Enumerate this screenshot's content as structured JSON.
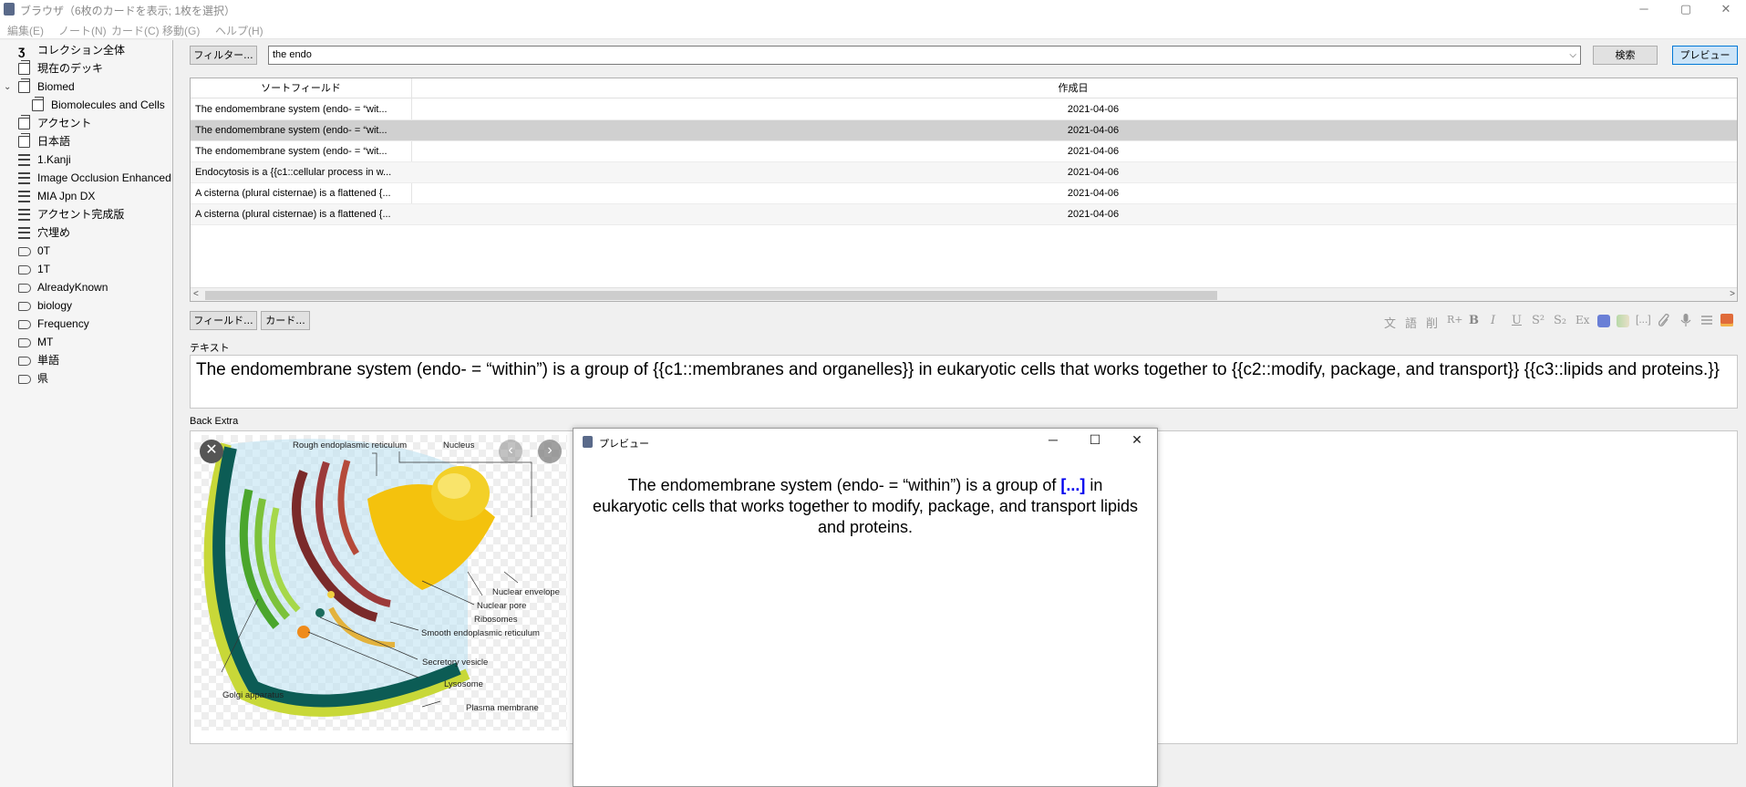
{
  "window": {
    "title": "ブラウザ（6枚のカードを表示; 1枚を選択）",
    "controls": [
      "─",
      "▢",
      "✕"
    ]
  },
  "menu": [
    "編集(E)",
    "ノート(N)",
    "カード(C)",
    "移動(G)",
    "ヘルプ(H)"
  ],
  "sidebar": {
    "items": [
      {
        "label": "コレクション全体",
        "icon": "collection-icon"
      },
      {
        "label": "現在のデッキ",
        "icon": "deck-icon"
      },
      {
        "label": "Biomed",
        "icon": "deck-icon",
        "expander": "⌄"
      },
      {
        "label": "Biomolecules and Cells",
        "icon": "deck-icon"
      },
      {
        "label": "アクセント",
        "icon": "deck-icon"
      },
      {
        "label": "日本語",
        "icon": "deck-icon"
      },
      {
        "label": "1.Kanji",
        "icon": "notetype-icon"
      },
      {
        "label": "Image Occlusion Enhanced",
        "icon": "notetype-icon"
      },
      {
        "label": "MIA Jpn DX",
        "icon": "notetype-icon"
      },
      {
        "label": "アクセント完成版",
        "icon": "notetype-icon"
      },
      {
        "label": "穴埋め",
        "icon": "notetype-icon"
      },
      {
        "label": "0T",
        "icon": "tag-icon"
      },
      {
        "label": "1T",
        "icon": "tag-icon"
      },
      {
        "label": "AlreadyKnown",
        "icon": "tag-icon"
      },
      {
        "label": "biology",
        "icon": "tag-icon"
      },
      {
        "label": "Frequency",
        "icon": "tag-icon"
      },
      {
        "label": "MT",
        "icon": "tag-icon"
      },
      {
        "label": "単語",
        "icon": "tag-icon"
      },
      {
        "label": "県",
        "icon": "tag-icon"
      }
    ]
  },
  "toolbar": {
    "filter_label": "フィルター...",
    "search_value": "the endo",
    "search_label": "検索",
    "preview_label": "プレビュー"
  },
  "table": {
    "columns": [
      "ソートフィールド",
      "作成日"
    ],
    "rows": [
      {
        "sort": "The endomembrane system (endo- = “wit...",
        "date": "2021-04-06"
      },
      {
        "sort": "The endomembrane system (endo- = “wit...",
        "date": "2021-04-06"
      },
      {
        "sort": "The endomembrane system (endo- = “wit...",
        "date": "2021-04-06"
      },
      {
        "sort": "Endocytosis is a {{c1::cellular process in w...",
        "date": "2021-04-06"
      },
      {
        "sort": "A cisterna (plural cisternae) is a flattened {...",
        "date": "2021-04-06"
      },
      {
        "sort": "A cisterna (plural cisternae) is a flattened {...",
        "date": "2021-04-06"
      }
    ],
    "selected_row": 1
  },
  "editor": {
    "fields_button": "フィールド...",
    "cards_button": "カード...",
    "format_icons": [
      "文",
      "語",
      "削",
      "R+",
      "B",
      "I",
      "U",
      "S²",
      "S₂",
      "Ex"
    ],
    "text_label": "テキスト",
    "text_value": "The endomembrane system (endo- = “within”) is a group of {{c1::membranes and organelles}} in eukaryotic cells that works together to {{c2::modify, package, and transport}} {{c3::lipids and proteins.}}",
    "back_extra_label": "Back Extra"
  },
  "image_labels": {
    "rough_er": "Rough endoplasmic reticulum",
    "nucleus": "Nucleus",
    "nuclear_envelope": "Nuclear envelope",
    "nuclear_pore": "Nuclear pore",
    "ribosomes": "Ribosomes",
    "smooth_er": "Smooth endoplasmic reticulum",
    "secretory_vesicle": "Secretory vesicle",
    "lysosome": "Lysosome",
    "golgi": "Golgi apparatus",
    "plasma_membrane": "Plasma membrane"
  },
  "preview": {
    "title": "プレビュー",
    "text_before": "The endomembrane system (endo- = “within”) is a group of ",
    "cloze": "[...]",
    "text_after": " in eukaryotic cells that works together to modify, package, and transport lipids and proteins."
  },
  "colors": {
    "selected_row": "#d0d0d0",
    "cloze": "#0000ee",
    "preview_button_active": "#cce4f7"
  }
}
